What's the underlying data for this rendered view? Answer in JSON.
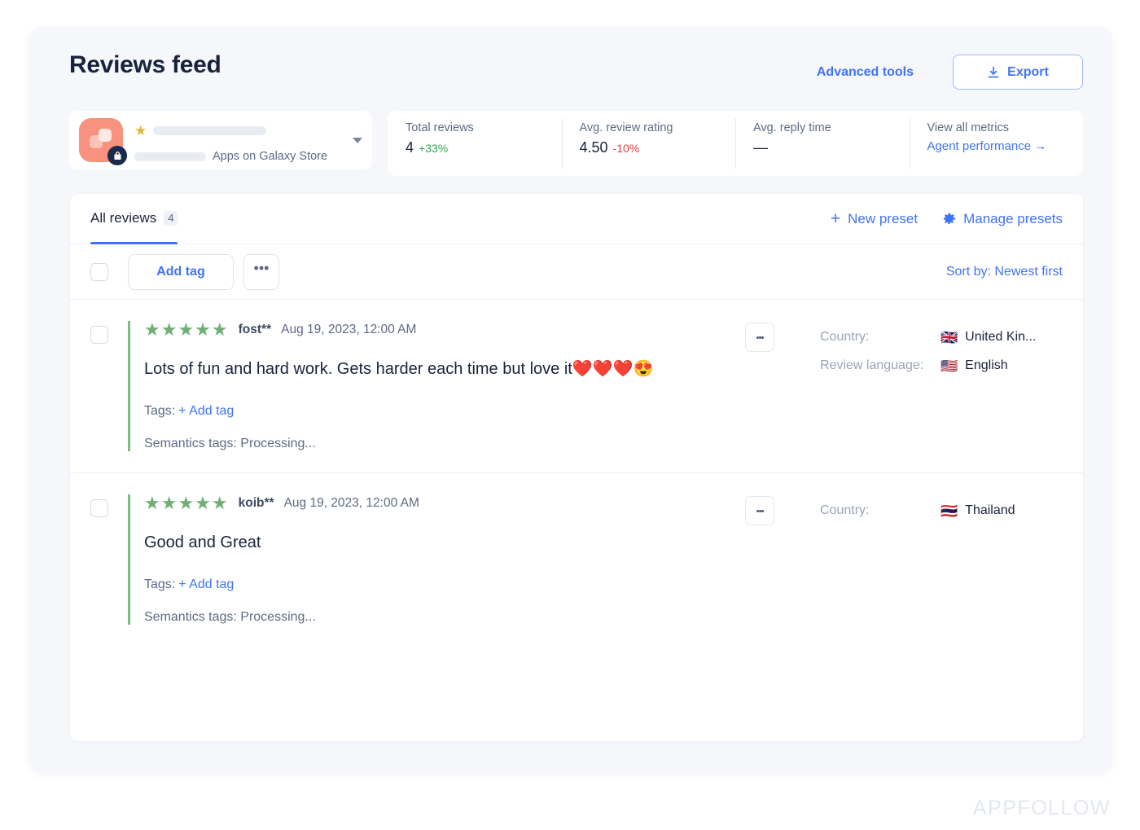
{
  "header": {
    "title": "Reviews feed",
    "advanced_tools_label": "Advanced tools",
    "export_label": "Export"
  },
  "app_selector": {
    "store_label": "Apps on Galaxy Store",
    "icon_name": "app-icon",
    "badge_icon": "store-bag-icon",
    "rating_star": "★"
  },
  "metrics": [
    {
      "label": "Total reviews",
      "value": "4",
      "delta": "+33%",
      "delta_dir": "up",
      "link": ""
    },
    {
      "label": "Avg. review rating",
      "value": "4.50",
      "delta": "-10%",
      "delta_dir": "down",
      "link": ""
    },
    {
      "label": "Avg. reply time",
      "value": "—",
      "delta": "",
      "delta_dir": "",
      "link": ""
    },
    {
      "label": "View all metrics",
      "value": "",
      "delta": "",
      "delta_dir": "",
      "link": "Agent performance →"
    }
  ],
  "tabs": {
    "items": [
      {
        "label": "All reviews",
        "count": "4",
        "active": true
      }
    ],
    "new_preset_label": "New preset",
    "new_preset_icon": "plus-icon",
    "manage_presets_label": "Manage presets",
    "manage_presets_icon": "gear-icon"
  },
  "bulk_toolbar": {
    "add_tag_label": "Add tag",
    "more_label": "•••",
    "sort_label": "Sort by: Newest first"
  },
  "reviews": [
    {
      "stars": "★★★★★",
      "rating": 5,
      "author": "fost**",
      "date": "Aug 19, 2023, 12:00 AM",
      "text": "Lots of fun and hard work. Gets harder each time but love it❤️❤️❤️😍",
      "tags_label": "Tags:",
      "add_tag_label": "+ Add tag",
      "semantics_label": "Semantics tags:",
      "semantics_value": "Processing...",
      "meta": [
        {
          "key": "Country:",
          "flag": "🇬🇧",
          "value": "United Kin..."
        },
        {
          "key": "Review language:",
          "flag": "🇺🇸",
          "value": "English"
        }
      ]
    },
    {
      "stars": "★★★★★",
      "rating": 5,
      "author": "koib**",
      "date": "Aug 19, 2023, 12:00 AM",
      "text": "Good and Great",
      "tags_label": "Tags:",
      "add_tag_label": "+ Add tag",
      "semantics_label": "Semantics tags:",
      "semantics_value": "Processing...",
      "meta": [
        {
          "key": "Country:",
          "flag": "🇹🇭",
          "value": "Thailand"
        }
      ]
    }
  ],
  "watermark": "APPFOLLOW",
  "colors": {
    "accent_blue": "#3f74f0",
    "star_green": "#6fae74",
    "positive": "#2fa84f",
    "negative": "#ea3d3d",
    "app_icon": "#f7927f",
    "panel_bg": "#f5f7fb"
  }
}
